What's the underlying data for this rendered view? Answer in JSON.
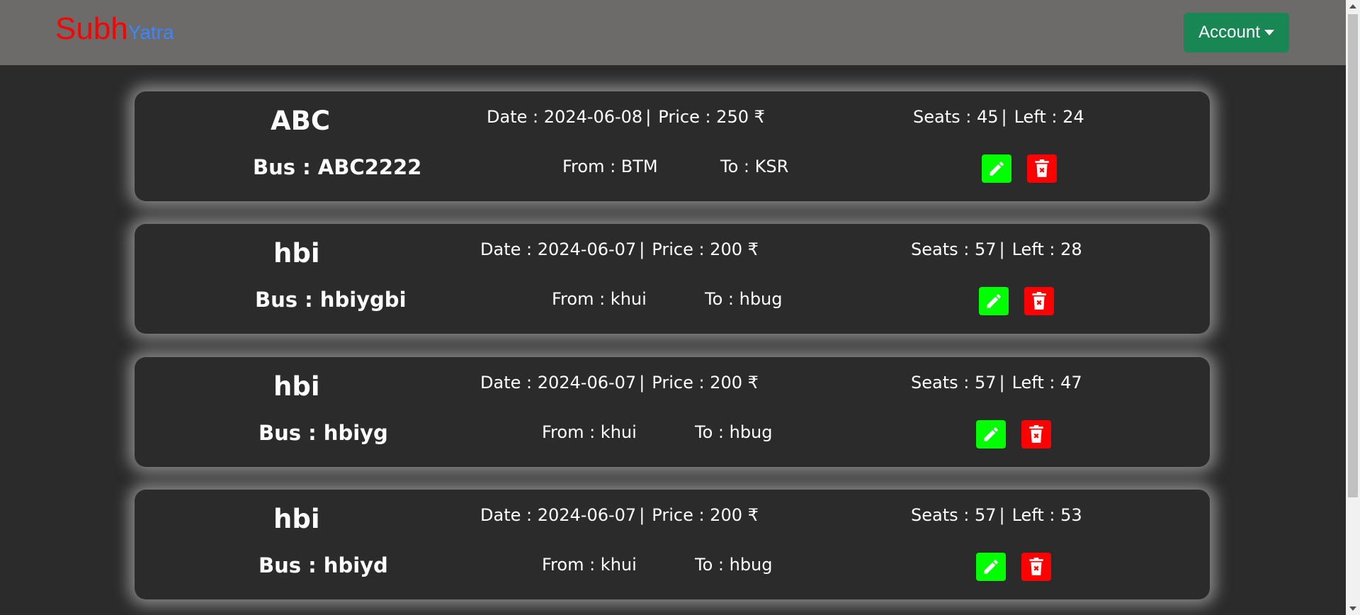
{
  "brand": {
    "main": "Subh",
    "sub": "Yatra",
    "main_color": "#ff0000",
    "sub_color": "#3a86ff"
  },
  "nav": {
    "account_label": "Account"
  },
  "colors": {
    "navbar": "#6c6b69",
    "page_bg": "#2b2b2b",
    "account_btn": "#198754",
    "edit_btn": "#00ff00",
    "delete_btn": "#ff0000"
  },
  "icons": {
    "edit": "pencil-icon",
    "delete": "trash-x-icon"
  },
  "trips": [
    {
      "name": "ABC",
      "date": "Date : 2024-06-08",
      "price": "Price : 250 ₹",
      "seats": "Seats : 45",
      "left": "Left : 24",
      "bus": "Bus : ABC2222",
      "from": "From : BTM",
      "to": "To : KSR"
    },
    {
      "name": "hbi",
      "date": "Date : 2024-06-07",
      "price": "Price : 200 ₹",
      "seats": "Seats : 57",
      "left": "Left : 28",
      "bus": "Bus : hbiygbi",
      "from": "From : khui",
      "to": "To : hbug"
    },
    {
      "name": "hbi",
      "date": "Date : 2024-06-07",
      "price": "Price : 200 ₹",
      "seats": "Seats : 57",
      "left": "Left : 47",
      "bus": "Bus : hbiyg",
      "from": "From : khui",
      "to": "To : hbug"
    },
    {
      "name": "hbi",
      "date": "Date : 2024-06-07",
      "price": "Price : 200 ₹",
      "seats": "Seats : 57",
      "left": "Left : 53",
      "bus": "Bus : hbiyd",
      "from": "From : khui",
      "to": "To : hbug"
    }
  ]
}
